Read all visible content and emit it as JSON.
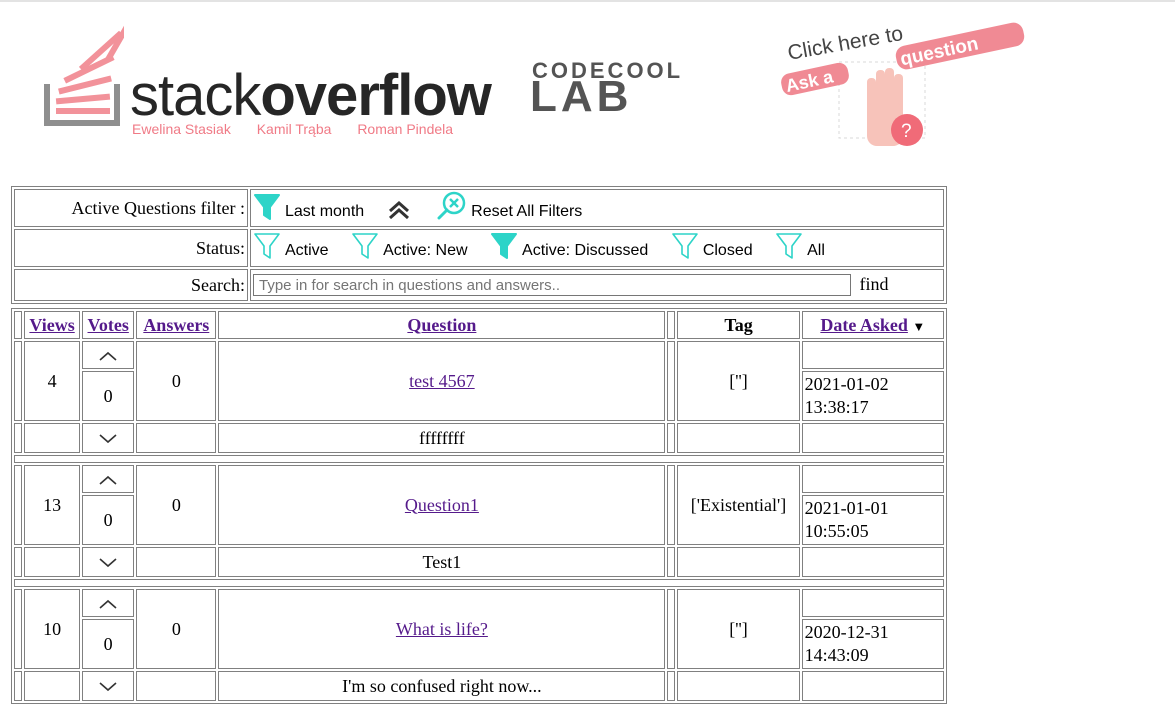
{
  "header": {
    "so_logo": {
      "word_light": "stack",
      "word_bold": "overflow",
      "authors": [
        "Ewelina Stasiak",
        "Kamil Trąba",
        "Roman Pindela"
      ]
    },
    "codecool_logo": {
      "top": "CODECOOL",
      "bottom": "LAB"
    },
    "ask_logo": {
      "line1": "Click here to",
      "word_ask": "Ask a",
      "word_question": "question"
    }
  },
  "filters": {
    "active_label": "Active Questions filter :",
    "last_month": "Last month",
    "reset": "Reset All Filters",
    "status_label": "Status:",
    "statuses": [
      {
        "label": "Active",
        "filled": false
      },
      {
        "label": "Active: New",
        "filled": false
      },
      {
        "label": "Active: Discussed",
        "filled": true
      },
      {
        "label": "Closed",
        "filled": false
      },
      {
        "label": "All",
        "filled": false
      }
    ],
    "search_label": "Search:",
    "search_placeholder": "Type in for search in questions and answers..",
    "find": "find"
  },
  "table": {
    "headers": {
      "views": "Views",
      "votes": "Votes",
      "answers": "Answers",
      "question": "Question",
      "tag": "Tag",
      "date": "Date Asked",
      "sort_arrow": "▼"
    },
    "rows": [
      {
        "views": "4",
        "votes": "0",
        "answers": "0",
        "title": "test 4567",
        "tag": "['']",
        "date1": "2021-01-02",
        "date2": "13:38:17",
        "desc": "ffffffff"
      },
      {
        "views": "13",
        "votes": "0",
        "answers": "0",
        "title": "Question1",
        "tag": "['Existential']",
        "date1": "2021-01-01",
        "date2": "10:55:05",
        "desc": "Test1"
      },
      {
        "views": "10",
        "votes": "0",
        "answers": "0",
        "title": "What is life?",
        "tag": "['']",
        "date1": "2020-12-31",
        "date2": "14:43:09",
        "desc": "I'm so confused right now..."
      }
    ]
  },
  "colors": {
    "accent": "#2dd4c8",
    "link": "#551a8b",
    "brand_pink": "#f07a86"
  }
}
